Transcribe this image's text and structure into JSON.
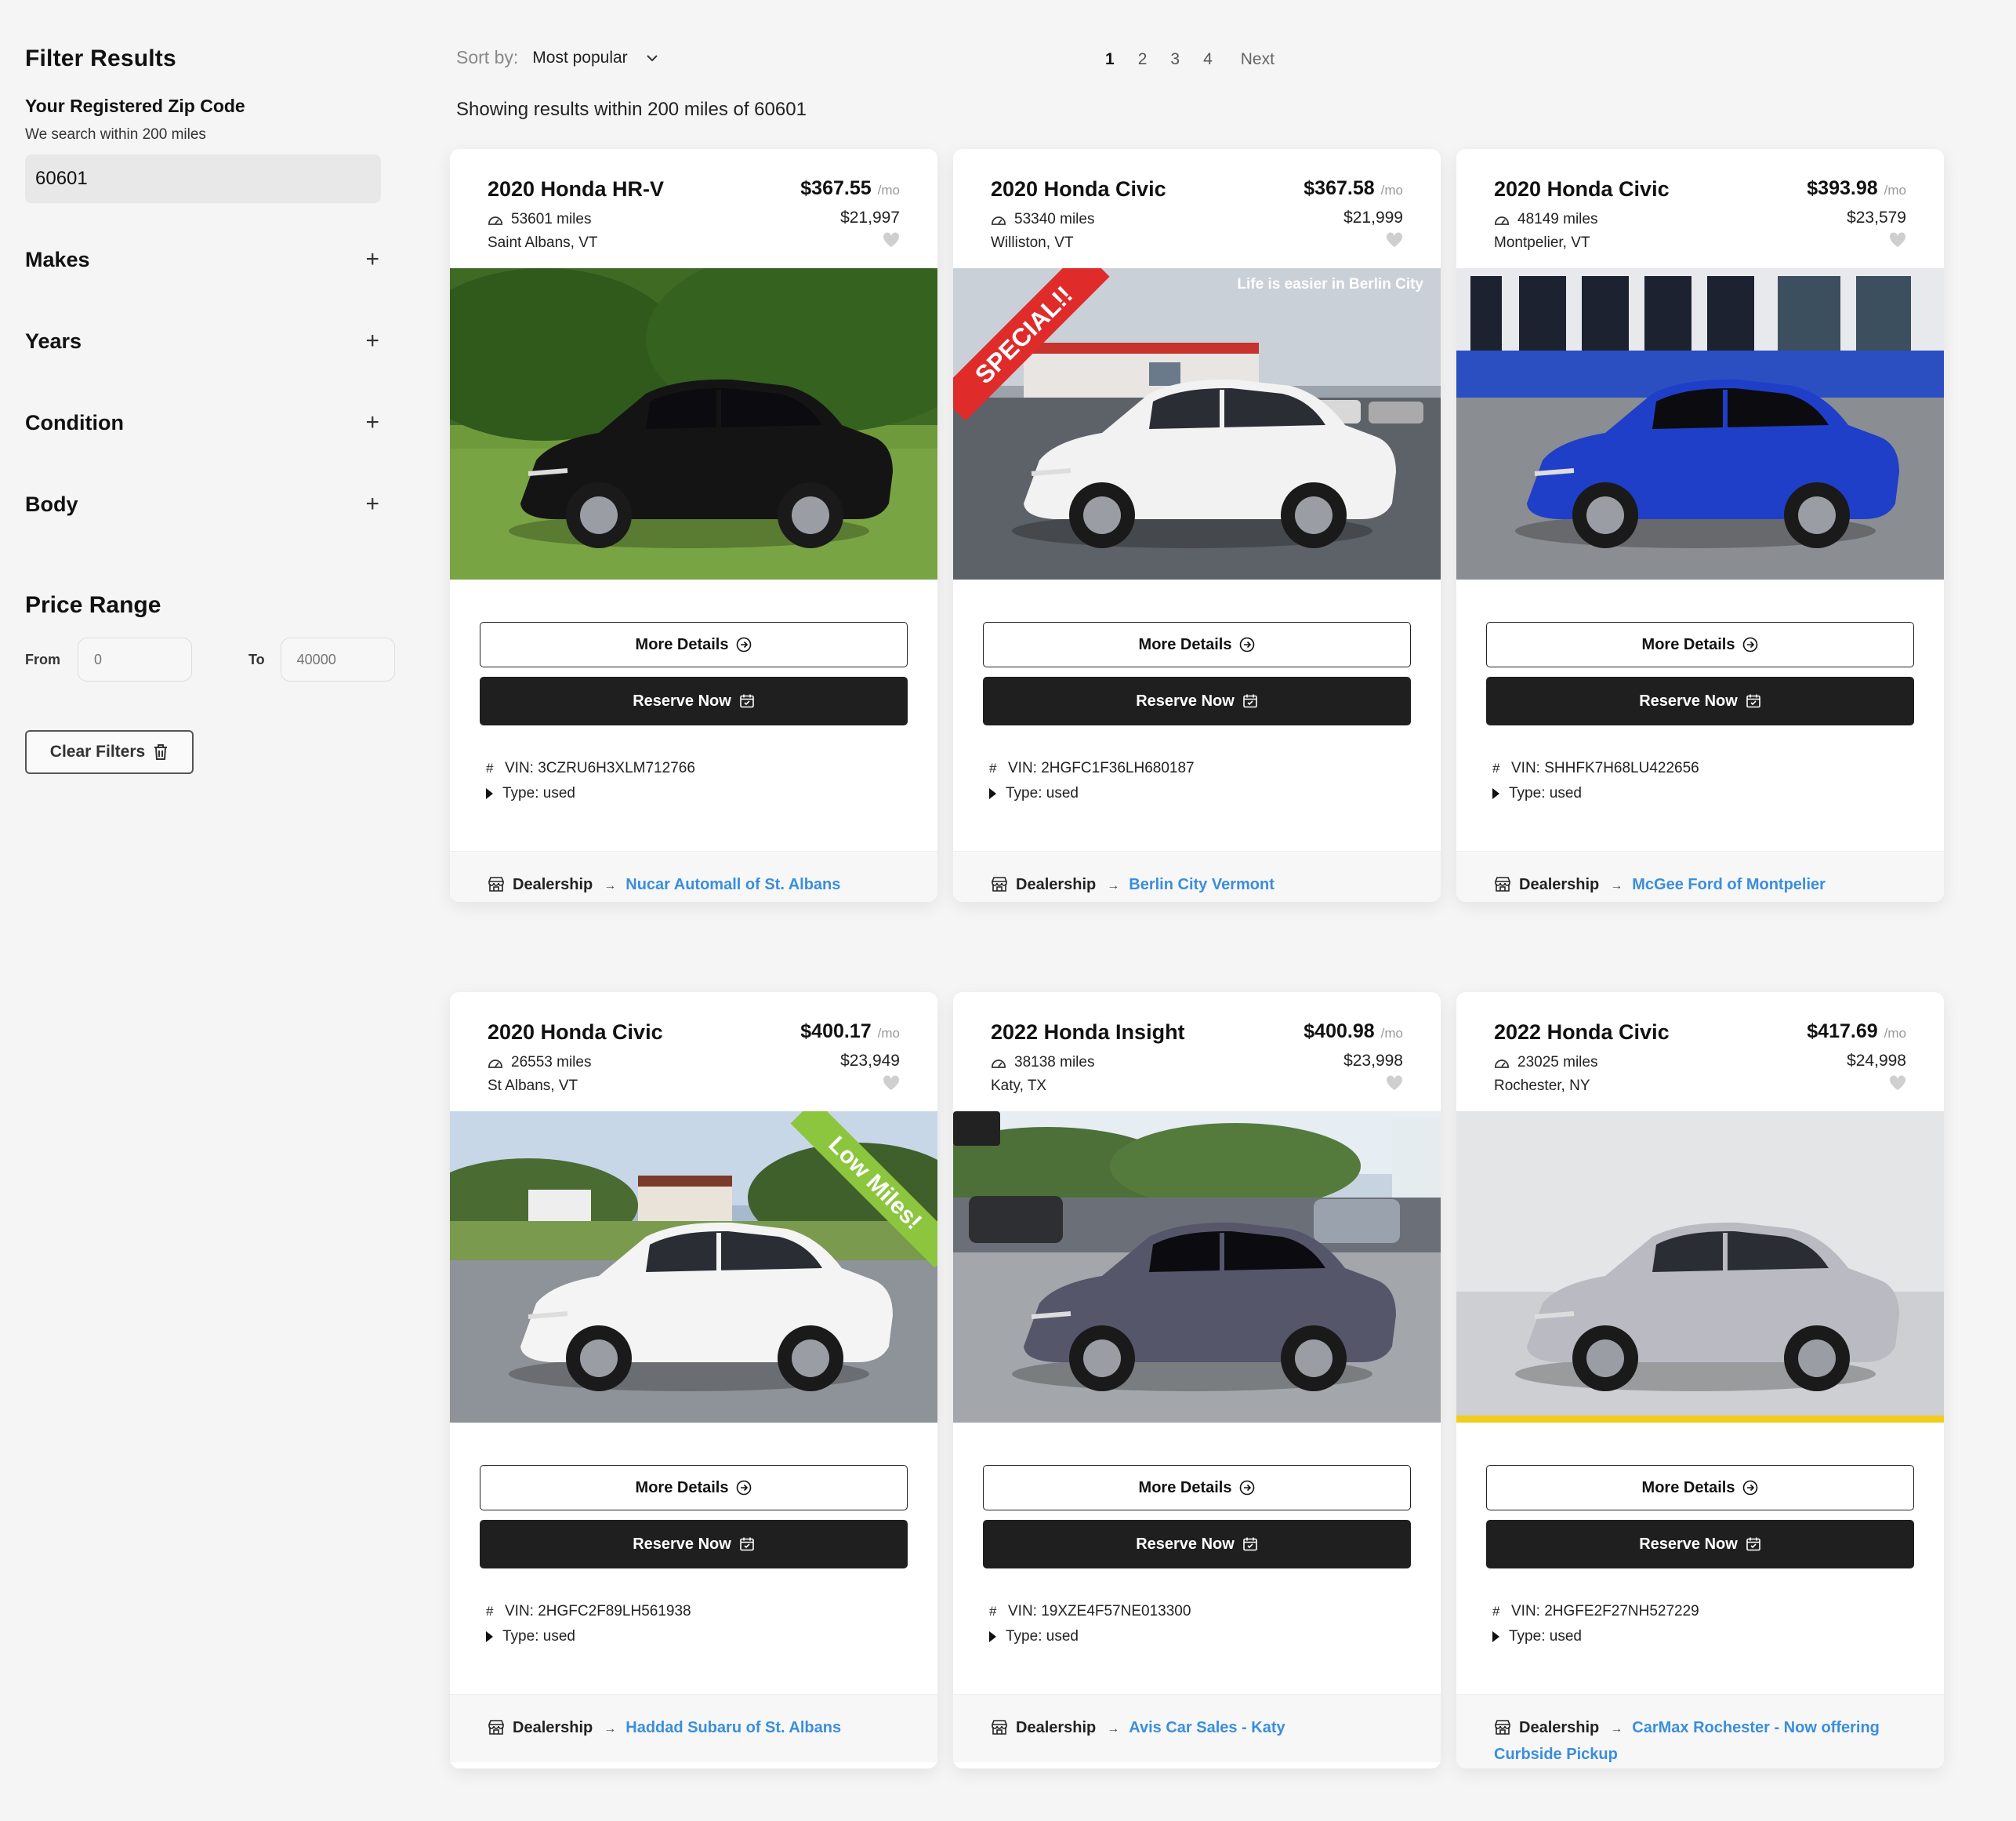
{
  "sidebar": {
    "title": "Filter Results",
    "zip_label": "Your Registered Zip Code",
    "zip_sub": "We search within 200 miles",
    "zip_value": "60601",
    "facets": [
      "Makes",
      "Years",
      "Condition",
      "Body"
    ],
    "price_title": "Price Range",
    "from_label": "From",
    "from_placeholder": "0",
    "to_label": "To",
    "to_placeholder": "40000",
    "clear_label": "Clear Filters"
  },
  "topbar": {
    "sort_label": "Sort by:",
    "sort_value": "Most popular",
    "pages": [
      "1",
      "2",
      "3",
      "4"
    ],
    "active_page": "1",
    "next_label": "Next",
    "showing": "Showing results within 200 miles of 60601"
  },
  "labels": {
    "per_month": "/mo",
    "more_details": "More Details",
    "reserve_now": "Reserve Now",
    "dealership": "Dealership"
  },
  "cars": [
    {
      "title": "2020 Honda HR-V",
      "monthly": "$367.55",
      "miles": "53601 miles",
      "location": "Saint Albans, VT",
      "price": "$21,997",
      "vin": "VIN: 3CZRU6H3XLM712766",
      "type": "Type: used",
      "dealer": "Nucar Automall of St. Albans",
      "car_color": "#141414",
      "scene": "grass",
      "banner": ""
    },
    {
      "title": "2020 Honda Civic",
      "monthly": "$367.58",
      "miles": "53340 miles",
      "location": "Williston, VT",
      "price": "$21,999",
      "vin": "VIN: 2HGFC1F36LH680187",
      "type": "Type: used",
      "dealer": "Berlin City Vermont",
      "car_color": "#f2f2f2",
      "scene": "lot",
      "banner": "SPECIAL!!",
      "caption": "Life is easier in Berlin City"
    },
    {
      "title": "2020 Honda Civic",
      "monthly": "$393.98",
      "miles": "48149 miles",
      "location": "Montpelier, VT",
      "price": "$23,579",
      "vin": "VIN: SHHFK7H68LU422656",
      "type": "Type: used",
      "dealer": "McGee Ford of Montpelier",
      "car_color": "#1f3fc8",
      "scene": "showroom",
      "banner": ""
    },
    {
      "title": "2020 Honda Civic",
      "monthly": "$400.17",
      "miles": "26553 miles",
      "location": "St Albans, VT",
      "price": "$23,949",
      "vin": "VIN: 2HGFC2F89LH561938",
      "type": "Type: used",
      "dealer": "Haddad Subaru of St. Albans",
      "car_color": "#f4f4f4",
      "scene": "field",
      "banner": "Low Miles!"
    },
    {
      "title": "2022 Honda Insight",
      "monthly": "$400.98",
      "miles": "38138 miles",
      "location": "Katy, TX",
      "price": "$23,998",
      "vin": "VIN: 19XZE4F57NE013300",
      "type": "Type: used",
      "dealer": "Avis Car Sales - Katy",
      "car_color": "#55566a",
      "scene": "dealer",
      "banner": ""
    },
    {
      "title": "2022 Honda Civic",
      "monthly": "$417.69",
      "miles": "23025 miles",
      "location": "Rochester, NY",
      "price": "$24,998",
      "vin": "VIN: 2HGFE2F27NH527229",
      "type": "Type: used",
      "dealer": "CarMax Rochester - Now offering Curbside Pickup",
      "car_color": "#b9bac2",
      "scene": "studio",
      "banner": ""
    }
  ]
}
